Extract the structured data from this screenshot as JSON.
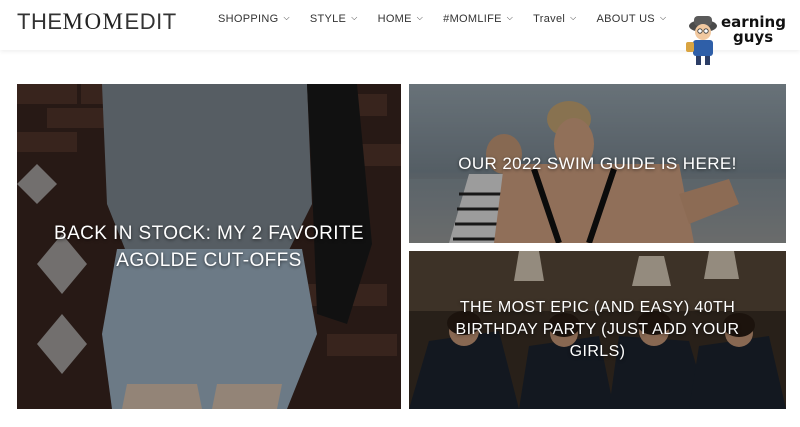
{
  "header": {
    "logo_thin": "THE",
    "logo_bold": "MOM",
    "logo_end": "EDIT",
    "nav": [
      {
        "label": "SHOPPING"
      },
      {
        "label": "STYLE"
      },
      {
        "label": "HOME"
      },
      {
        "label": "#MOMLIFE"
      },
      {
        "label": "Travel"
      },
      {
        "label": "ABOUT US"
      }
    ]
  },
  "badge": {
    "line1": "earning",
    "line2": "guys"
  },
  "tiles": [
    {
      "title": "BACK IN STOCK: MY 2 FAVORITE AGOLDE CUT-OFFS"
    },
    {
      "title": "OUR 2022 SWIM GUIDE IS HERE!"
    },
    {
      "title": "THE MOST EPIC (AND EASY) 40TH BIRTHDAY PARTY (JUST ADD YOUR GIRLS)"
    }
  ],
  "colors": {
    "text": "#333333",
    "tile_overlay": "#000000"
  }
}
